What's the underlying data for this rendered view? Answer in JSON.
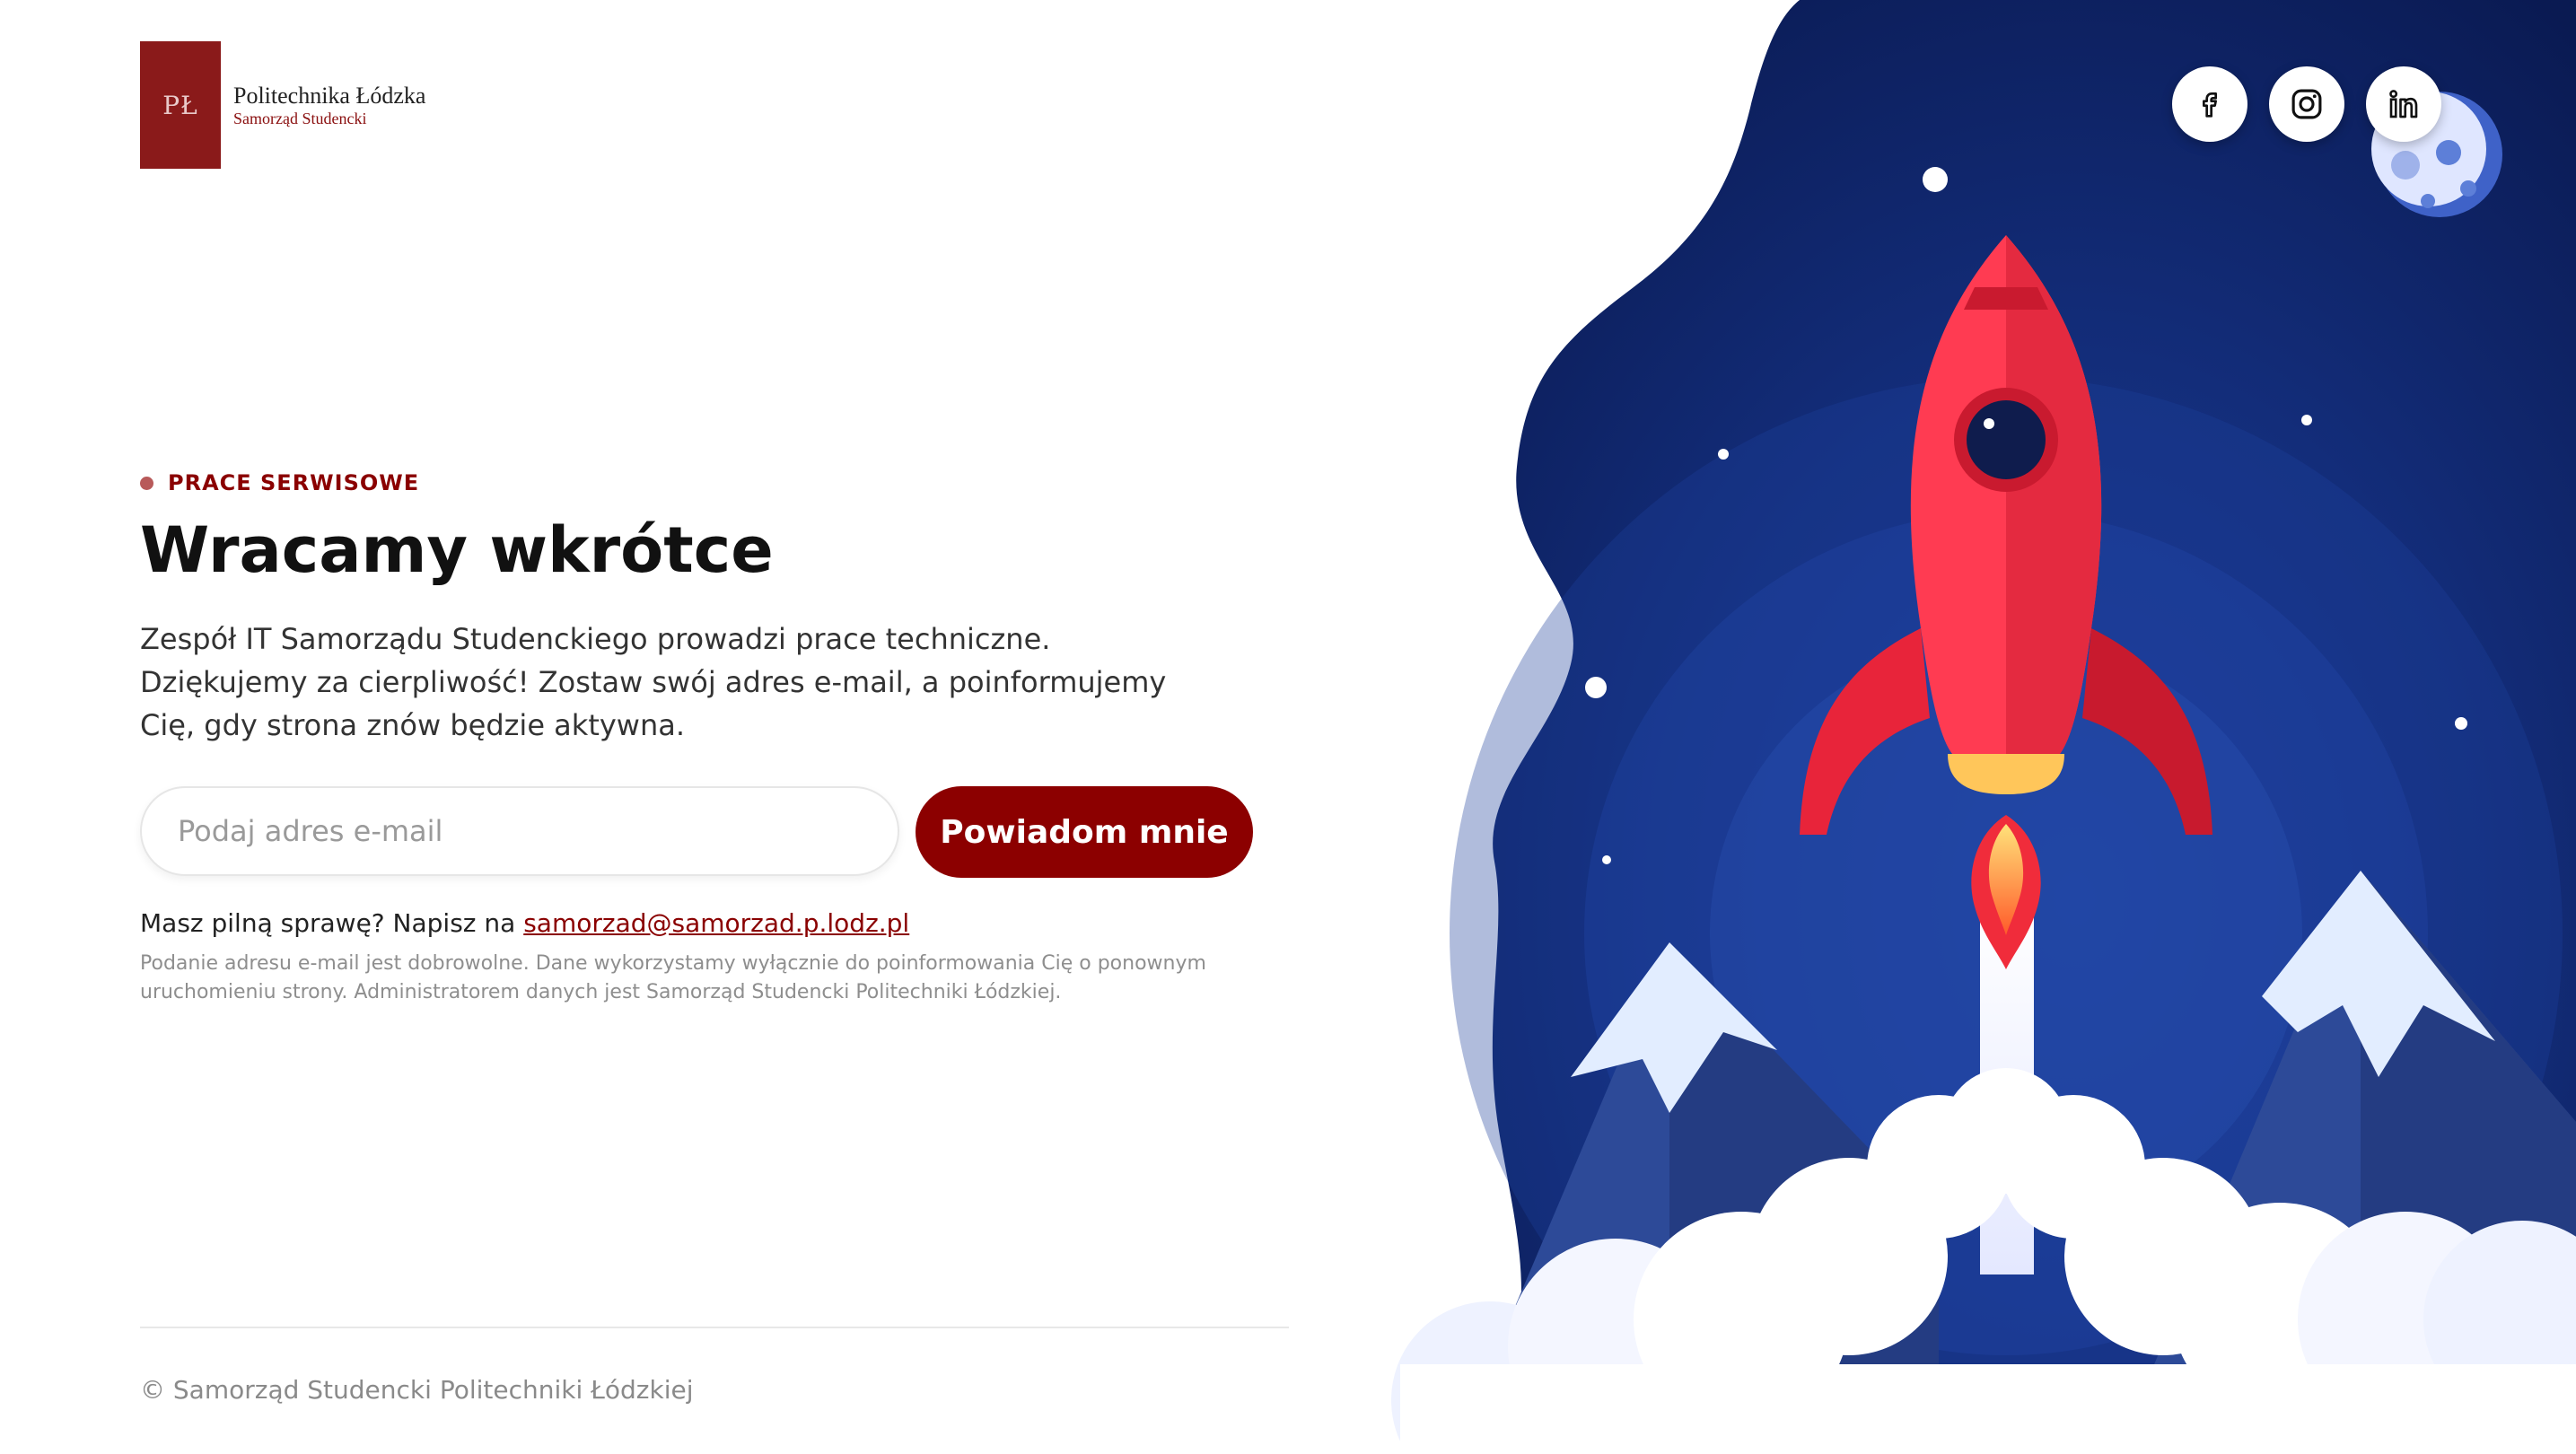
{
  "brand": {
    "name": "Politechnika Łódzka",
    "subtitle": "Samorząd Studencki",
    "crest_text": "PŁ",
    "color": "#8a1a1a"
  },
  "status": {
    "label": "PRACE SERWISOWE"
  },
  "main": {
    "title": "Wracamy wkrótce",
    "description": "Zespół IT Samorządu Studenckiego prowadzi prace techniczne. Dziękujemy za cierpliwość! Zostaw swój adres e-mail, a poinformujemy Cię, gdy strona znów będzie aktywna."
  },
  "form": {
    "email_placeholder": "Podaj adres e-mail",
    "email_value": "",
    "submit_label": "Powiadom mnie"
  },
  "contact": {
    "prefix": "Masz pilną sprawę? Napisz na ",
    "email": "samorzad@samorzad.p.lodz.pl"
  },
  "privacy_note": "Podanie adresu e-mail jest dobrowolne. Dane wykorzystamy wyłącznie do poinformowania Cię o ponownym uruchomieniu strony. Administratorem danych jest Samorząd Studencki Politechniki Łódzkiej.",
  "footer": {
    "copyright": "© Samorząd Studencki Politechniki Łódzkiej"
  },
  "socials": [
    {
      "name": "facebook",
      "icon": "facebook-icon"
    },
    {
      "name": "instagram",
      "icon": "instagram-icon"
    },
    {
      "name": "linkedin",
      "icon": "linkedin-icon"
    }
  ],
  "colors": {
    "accent": "#8c0000",
    "space_dark": "#0d1d5c",
    "rocket": "#f23a4e"
  }
}
